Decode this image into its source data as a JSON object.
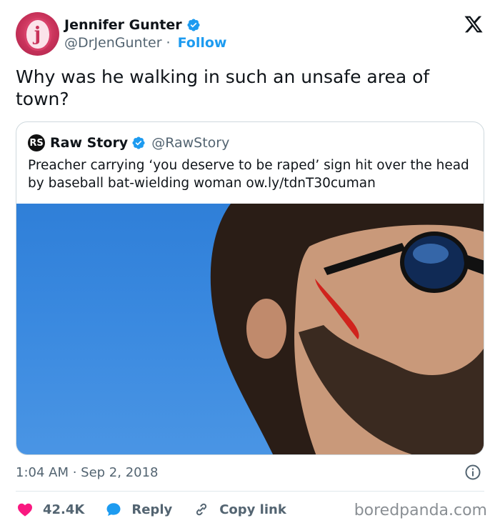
{
  "author": {
    "display_name": "Jennifer Gunter",
    "handle": "@DrJenGunter",
    "separator": "·",
    "follow_label": "Follow",
    "avatar_letter": "j"
  },
  "tweet": {
    "text": "Why was he walking in such an unsafe area of town?",
    "timestamp": "1:04 AM · Sep 2, 2018"
  },
  "quote": {
    "logo_letters": "RS",
    "name": "Raw Story",
    "handle": "@RawStory",
    "text": "Preacher carrying ‘you deserve to be raped’ sign hit over the head by baseball bat-wielding woman ow.ly/tdnT30cuman"
  },
  "actions": {
    "likes": "42.4K",
    "reply_label": "Reply",
    "copy_link_label": "Copy link"
  },
  "watermark": "boredpanda.com",
  "colors": {
    "accent": "#1d9bf0",
    "like": "#f91880",
    "text_secondary": "#536471"
  },
  "icons": [
    "verified-badge-icon",
    "x-logo-icon",
    "info-icon",
    "heart-icon",
    "reply-bubble-icon",
    "link-icon"
  ]
}
